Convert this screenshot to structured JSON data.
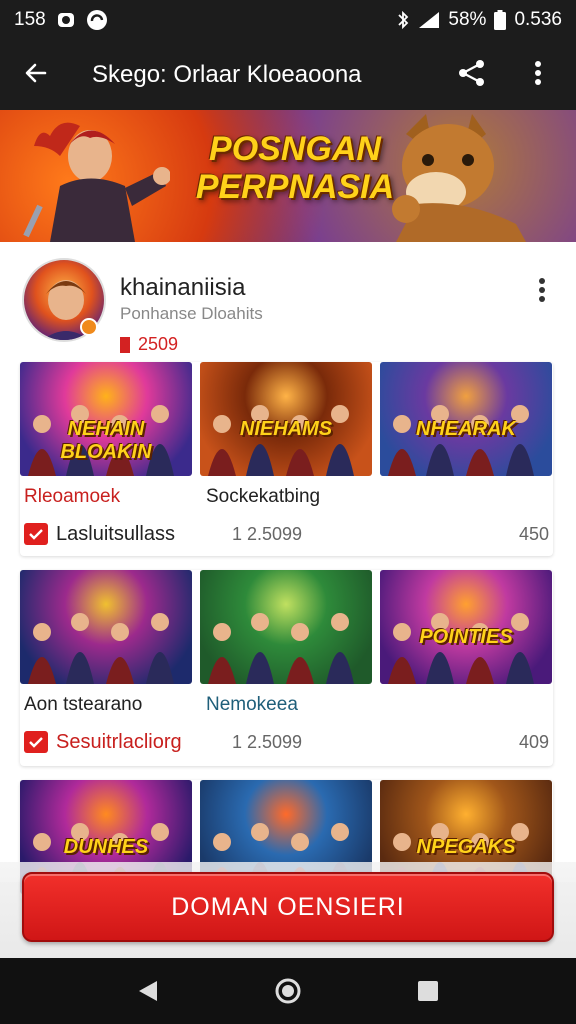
{
  "status_bar": {
    "time": "158",
    "battery": "58%",
    "clock_right": "0.536",
    "icons": [
      "app-notification-icon",
      "sync-icon",
      "bluetooth-icon",
      "signal-icon",
      "battery-icon"
    ]
  },
  "app_bar": {
    "title": "Skego: Orlaar Kloeaoona",
    "back_icon": "arrow-back-icon",
    "share_icon": "share-icon",
    "more_icon": "more-vert-icon"
  },
  "banner": {
    "title_line1": "POSNGAN",
    "title_line2": "PERPNASIA"
  },
  "profile": {
    "name": "khainaniisia",
    "subtitle": "Ponhanse Dloahits",
    "count": "2509"
  },
  "sections": [
    {
      "thumbs": [
        {
          "label": "NEHAIN BLOAKIN",
          "palette": [
            "#3b2a8c",
            "#e03a9a",
            "#ffb21a"
          ]
        },
        {
          "label": "NIEHAMS",
          "palette": [
            "#c8521a",
            "#7a2a0a",
            "#ffb347"
          ]
        },
        {
          "label": "NHEARAK",
          "palette": [
            "#2b4c9c",
            "#6a3aa0",
            "#f0a040"
          ]
        }
      ],
      "label_left": "Rleoamoek",
      "label_mid": "Sockekatbing",
      "meta_label": "Lasluitsullass",
      "meta_num": "1 2.5099",
      "meta_right": "450"
    },
    {
      "thumbs": [
        {
          "label": "",
          "palette": [
            "#1d2a6c",
            "#9c2a8c",
            "#f0c030"
          ]
        },
        {
          "label": "",
          "palette": [
            "#1f5a2a",
            "#2e8a3a",
            "#c0e060"
          ]
        },
        {
          "label": "POINTIES",
          "palette": [
            "#4a1a7a",
            "#c03aa0",
            "#ffa030"
          ]
        }
      ],
      "label_left": "Aon tstearano",
      "label_mid": "Nemokeea",
      "meta_label": "Sesuitrlacliorg",
      "meta_num": "1 2.5099",
      "meta_right": "409"
    },
    {
      "thumbs": [
        {
          "label": "DUNHES",
          "palette": [
            "#2a1a6a",
            "#b02a9a",
            "#ff8a20"
          ]
        },
        {
          "label": "",
          "palette": [
            "#1a3a6a",
            "#2a6ab0",
            "#ff6a2a"
          ]
        },
        {
          "label": "NPEGAKS",
          "palette": [
            "#5a2a10",
            "#a0561a",
            "#ffb030"
          ]
        }
      ]
    }
  ],
  "cta": {
    "label": "DOMAN OENSIERI"
  },
  "nav": {
    "back_icon": "nav-back-icon",
    "home_icon": "nav-home-icon",
    "recents_icon": "nav-recents-icon"
  },
  "colors": {
    "accent": "#e0201e",
    "bar": "#1c1c1c",
    "gold": "#ffd21a"
  }
}
